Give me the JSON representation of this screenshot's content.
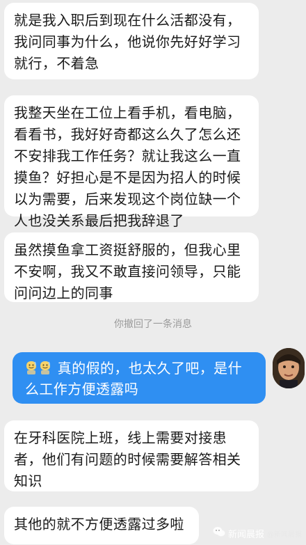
{
  "messages": {
    "m1": "就是我入职后到现在什么活都没有，我问同事为什么，他说你先好好学习就行，不着急",
    "m2": "我整天坐在工位上看手机，看电脑，看看书，我好好奇都这么久了怎么还不安排我工作任务？就让我这么一直摸鱼？好担心是不是因为招人的时候以为需要，后来发现这个岗位缺一个人也没关系最后把我辞退了",
    "m3": "虽然摸鱼拿工资挺舒服的，但我心里不安啊，我又不敢直接问领导，只能问问边上的同事",
    "recall_notice": "你撤回了一条消息",
    "outgoing": "真的假的，也太久了吧，是什么工作方便透露吗",
    "m5": "在牙科医院上班，线上需要对接患者，他们有问题的时候需要解答相关知识",
    "m6": "其他的就不方便透露过多啦"
  },
  "watermark": {
    "brand": "新闻晨报",
    "sub": "@新闻晨报"
  },
  "colors": {
    "background": "#ececec",
    "incoming_bubble": "#ffffff",
    "outgoing_bubble": "#2f8ff2"
  }
}
